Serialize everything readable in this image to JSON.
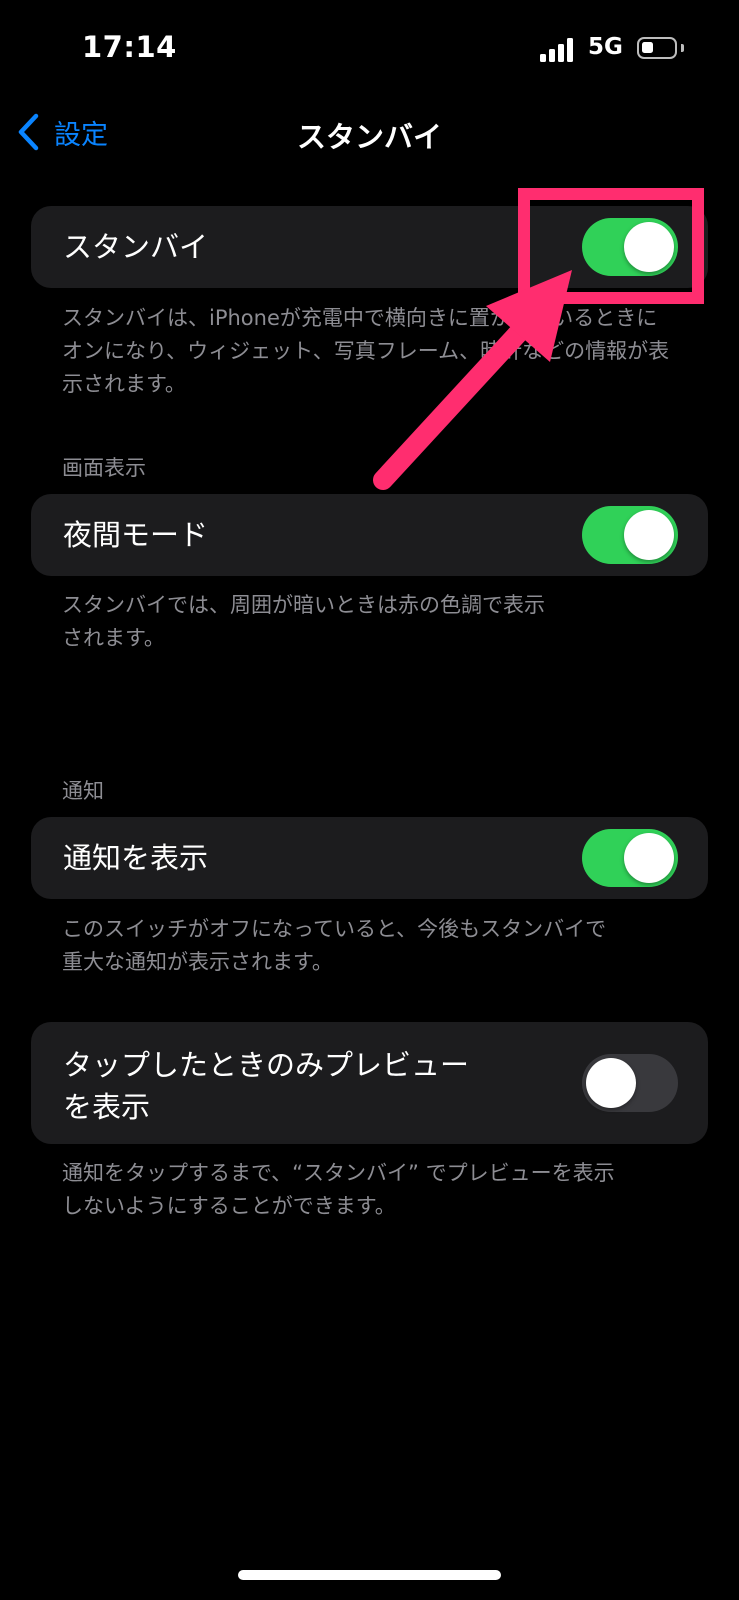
{
  "status_bar": {
    "time": "17:14",
    "network": "5G",
    "icons": [
      "cellular-signal-icon",
      "battery-icon"
    ]
  },
  "nav": {
    "back_label": "設定",
    "title": "スタンバイ",
    "icons": [
      "chevron-left-icon"
    ]
  },
  "standby": {
    "label": "スタンバイ",
    "enabled": true,
    "footer": "スタンバイは、iPhoneが充電中で横向きに置かれているときにオンになり、ウィジェット、写真フレーム、時計などの情報が表示されます。"
  },
  "display_section": {
    "header": "画面表示",
    "night_mode_label": "夜間モード",
    "night_mode_enabled": true,
    "footer": "スタンバイでは、周囲が暗いときは赤の色調で表示\nされます。"
  },
  "notifications_section": {
    "header": "通知",
    "show_label": "通知を表示",
    "show_enabled": true,
    "footer": "このスイッチがオフになっていると、今後もスタンバイで\n重大な通知が表示されます。"
  },
  "preview": {
    "label": "タップしたときのみプレビュー\nを表示",
    "enabled": false,
    "footer": "通知をタップするまで、“スタンバイ” でプレビューを表示\nしないようにすることができます。"
  },
  "colors": {
    "background": "#000000",
    "cell": "#1c1c1e",
    "toggle_on": "#30d158",
    "toggle_off": "#39393d",
    "link": "#0a84ff",
    "annotation": "#ff2d6f"
  }
}
